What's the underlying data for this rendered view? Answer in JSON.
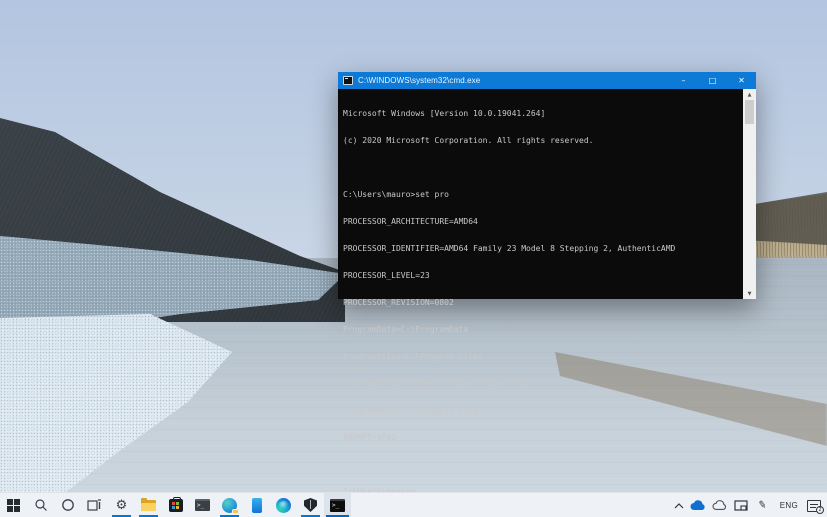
{
  "window": {
    "title": "C:\\WINDOWS\\system32\\cmd.exe",
    "controls": {
      "minimize": "–",
      "maximize": "□",
      "close": "✕"
    }
  },
  "terminal": {
    "lines": [
      "Microsoft Windows [Version 10.0.19041.264]",
      "(c) 2020 Microsoft Corporation. All rights reserved.",
      "",
      "C:\\Users\\mauro>set pro",
      "PROCESSOR_ARCHITECTURE=AMD64",
      "PROCESSOR_IDENTIFIER=AMD64 Family 23 Model 8 Stepping 2, AuthenticAMD",
      "PROCESSOR_LEVEL=23",
      "PROCESSOR_REVISION=0802",
      "ProgramData=C:\\ProgramData",
      "ProgramFiles=C:\\Program Files",
      "ProgramFiles(x86)=C:\\Program Files (x86)",
      "ProgramW6432=C:\\Program Files",
      "PROMPT=$P$G",
      ""
    ],
    "prompt": "C:\\Users\\mauro>",
    "cursor": "_"
  },
  "icons": {
    "gear": "⚙",
    "search": "⌕",
    "pen": "✎",
    "scroll_up": "▲",
    "scroll_down": "▼",
    "chevron_up": "∧",
    "cloud_filled": "☁",
    "cloud_outline": "☁",
    "cmd_glyph": ">_"
  },
  "taskbar": {
    "items": [
      "start",
      "search",
      "cortana",
      "task-view",
      "settings",
      "file-explorer",
      "microsoft-store",
      "command-prompt-pinned",
      "edge-dev",
      "your-phone",
      "edge",
      "security-shield",
      "command-prompt-active"
    ],
    "running_items": [
      "settings",
      "file-explorer",
      "edge-dev",
      "security-shield",
      "command-prompt-active"
    ],
    "active_item": "command-prompt-active",
    "tray": {
      "language": "ENG",
      "notification_badge": "2"
    }
  },
  "colors": {
    "titlebar": "#0d7ad7",
    "accent_underline": "#0078d7",
    "console_bg": "#0b0b0b",
    "console_text": "#c9c9c9",
    "taskbar_bg": "#eef1f5"
  }
}
